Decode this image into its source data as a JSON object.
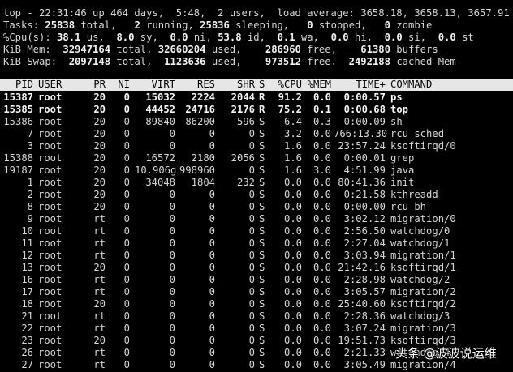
{
  "summary": {
    "l1": [
      {
        "t": "top - 22:31:46 up 464 days,  5:48,  2 users,  load average: 3658.18, 3658.13, 3657.91",
        "b": false
      }
    ],
    "l2": [
      {
        "t": "Tasks: ",
        "b": false
      },
      {
        "t": "25838",
        "b": true
      },
      {
        "t": " total,   ",
        "b": false
      },
      {
        "t": "2",
        "b": true
      },
      {
        "t": " running, ",
        "b": false
      },
      {
        "t": "25836",
        "b": true
      },
      {
        "t": " sleeping,   ",
        "b": false
      },
      {
        "t": "0",
        "b": true
      },
      {
        "t": " stopped,   ",
        "b": false
      },
      {
        "t": "0",
        "b": true
      },
      {
        "t": " zombie",
        "b": false
      }
    ],
    "l3": [
      {
        "t": "%Cpu(s): ",
        "b": false
      },
      {
        "t": "38.1",
        "b": true
      },
      {
        "t": " us,  ",
        "b": false
      },
      {
        "t": "8.0",
        "b": true
      },
      {
        "t": " sy,  ",
        "b": false
      },
      {
        "t": "0.0",
        "b": true
      },
      {
        "t": " ni, ",
        "b": false
      },
      {
        "t": "53.8",
        "b": true
      },
      {
        "t": " id,  ",
        "b": false
      },
      {
        "t": "0.1",
        "b": true
      },
      {
        "t": " wa,  ",
        "b": false
      },
      {
        "t": "0.0",
        "b": true
      },
      {
        "t": " hi,  ",
        "b": false
      },
      {
        "t": "0.0",
        "b": true
      },
      {
        "t": " si,  ",
        "b": false
      },
      {
        "t": "0.0",
        "b": true
      },
      {
        "t": " st",
        "b": false
      }
    ],
    "l4": [
      {
        "t": "KiB Mem:  ",
        "b": false
      },
      {
        "t": "32947164",
        "b": true
      },
      {
        "t": " total, ",
        "b": false
      },
      {
        "t": "32660204",
        "b": true
      },
      {
        "t": " used,    ",
        "b": false
      },
      {
        "t": "286960",
        "b": true
      },
      {
        "t": " free,    ",
        "b": false
      },
      {
        "t": "61380",
        "b": true
      },
      {
        "t": " buffers",
        "b": false
      }
    ],
    "l5": [
      {
        "t": "KiB Swap:  ",
        "b": false
      },
      {
        "t": "2097148",
        "b": true
      },
      {
        "t": " total,  ",
        "b": false
      },
      {
        "t": "1123636",
        "b": true
      },
      {
        "t": " used,    ",
        "b": false
      },
      {
        "t": "973512",
        "b": true
      },
      {
        "t": " free.  ",
        "b": false
      },
      {
        "t": "2492188",
        "b": true
      },
      {
        "t": " cached Mem",
        "b": false
      }
    ]
  },
  "columns": [
    "PID",
    "USER",
    "PR",
    "NI",
    "VIRT",
    "RES",
    "SHR",
    "S",
    "%CPU",
    "%MEM",
    "TIME+",
    "COMMAND"
  ],
  "processes": [
    {
      "pid": "15387",
      "user": "root",
      "pr": "20",
      "ni": "0",
      "virt": "15032",
      "res": "2224",
      "shr": "2044",
      "s": "R",
      "cpu": "91.2",
      "mem": "0.0",
      "time": "0:00.57",
      "cmd": "ps",
      "bold": true
    },
    {
      "pid": "15385",
      "user": "root",
      "pr": "20",
      "ni": "0",
      "virt": "44452",
      "res": "24716",
      "shr": "2176",
      "s": "R",
      "cpu": "75.2",
      "mem": "0.1",
      "time": "0:00.68",
      "cmd": "top",
      "bold": true
    },
    {
      "pid": "15386",
      "user": "root",
      "pr": "20",
      "ni": "0",
      "virt": "89840",
      "res": "86200",
      "shr": "596",
      "s": "S",
      "cpu": "6.4",
      "mem": "0.3",
      "time": "0:00.09",
      "cmd": "sh",
      "bold": false
    },
    {
      "pid": "7",
      "user": "root",
      "pr": "20",
      "ni": "0",
      "virt": "0",
      "res": "0",
      "shr": "0",
      "s": "S",
      "cpu": "3.2",
      "mem": "0.0",
      "time": "766:13.30",
      "cmd": "rcu_sched",
      "bold": false
    },
    {
      "pid": "3",
      "user": "root",
      "pr": "20",
      "ni": "0",
      "virt": "0",
      "res": "0",
      "shr": "0",
      "s": "S",
      "cpu": "1.6",
      "mem": "0.0",
      "time": "23:57.24",
      "cmd": "ksoftirqd/0",
      "bold": false
    },
    {
      "pid": "15388",
      "user": "root",
      "pr": "20",
      "ni": "0",
      "virt": "16572",
      "res": "2180",
      "shr": "2056",
      "s": "S",
      "cpu": "1.6",
      "mem": "0.0",
      "time": "0:00.01",
      "cmd": "grep",
      "bold": false
    },
    {
      "pid": "19187",
      "user": "root",
      "pr": "20",
      "ni": "0",
      "virt": "10.906g",
      "res": "998960",
      "shr": "0",
      "s": "S",
      "cpu": "1.6",
      "mem": "3.0",
      "time": "4:51.99",
      "cmd": "java",
      "bold": false
    },
    {
      "pid": "1",
      "user": "root",
      "pr": "20",
      "ni": "0",
      "virt": "34048",
      "res": "1804",
      "shr": "232",
      "s": "S",
      "cpu": "0.0",
      "mem": "0.0",
      "time": "80:41.36",
      "cmd": "init",
      "bold": false
    },
    {
      "pid": "2",
      "user": "root",
      "pr": "20",
      "ni": "0",
      "virt": "0",
      "res": "0",
      "shr": "0",
      "s": "S",
      "cpu": "0.0",
      "mem": "0.0",
      "time": "0:21.58",
      "cmd": "kthreadd",
      "bold": false
    },
    {
      "pid": "8",
      "user": "root",
      "pr": "20",
      "ni": "0",
      "virt": "0",
      "res": "0",
      "shr": "0",
      "s": "S",
      "cpu": "0.0",
      "mem": "0.0",
      "time": "0:00.00",
      "cmd": "rcu_bh",
      "bold": false
    },
    {
      "pid": "9",
      "user": "root",
      "pr": "rt",
      "ni": "0",
      "virt": "0",
      "res": "0",
      "shr": "0",
      "s": "S",
      "cpu": "0.0",
      "mem": "0.0",
      "time": "3:02.12",
      "cmd": "migration/0",
      "bold": false
    },
    {
      "pid": "10",
      "user": "root",
      "pr": "rt",
      "ni": "0",
      "virt": "0",
      "res": "0",
      "shr": "0",
      "s": "S",
      "cpu": "0.0",
      "mem": "0.0",
      "time": "2:56.50",
      "cmd": "watchdog/0",
      "bold": false
    },
    {
      "pid": "11",
      "user": "root",
      "pr": "rt",
      "ni": "0",
      "virt": "0",
      "res": "0",
      "shr": "0",
      "s": "S",
      "cpu": "0.0",
      "mem": "0.0",
      "time": "2:27.04",
      "cmd": "watchdog/1",
      "bold": false
    },
    {
      "pid": "12",
      "user": "root",
      "pr": "rt",
      "ni": "0",
      "virt": "0",
      "res": "0",
      "shr": "0",
      "s": "S",
      "cpu": "0.0",
      "mem": "0.0",
      "time": "3:03.94",
      "cmd": "migration/1",
      "bold": false
    },
    {
      "pid": "13",
      "user": "root",
      "pr": "20",
      "ni": "0",
      "virt": "0",
      "res": "0",
      "shr": "0",
      "s": "S",
      "cpu": "0.0",
      "mem": "0.0",
      "time": "21:42.16",
      "cmd": "ksoftirqd/1",
      "bold": false
    },
    {
      "pid": "16",
      "user": "root",
      "pr": "rt",
      "ni": "0",
      "virt": "0",
      "res": "0",
      "shr": "0",
      "s": "S",
      "cpu": "0.0",
      "mem": "0.0",
      "time": "2:28.98",
      "cmd": "watchdog/2",
      "bold": false
    },
    {
      "pid": "17",
      "user": "root",
      "pr": "rt",
      "ni": "0",
      "virt": "0",
      "res": "0",
      "shr": "0",
      "s": "S",
      "cpu": "0.0",
      "mem": "0.0",
      "time": "3:05.57",
      "cmd": "migration/2",
      "bold": false
    },
    {
      "pid": "18",
      "user": "root",
      "pr": "20",
      "ni": "0",
      "virt": "0",
      "res": "0",
      "shr": "0",
      "s": "S",
      "cpu": "0.0",
      "mem": "0.0",
      "time": "25:40.60",
      "cmd": "ksoftirqd/2",
      "bold": false
    },
    {
      "pid": "21",
      "user": "root",
      "pr": "rt",
      "ni": "0",
      "virt": "0",
      "res": "0",
      "shr": "0",
      "s": "S",
      "cpu": "0.0",
      "mem": "0.0",
      "time": "2:28.36",
      "cmd": "watchdog/3",
      "bold": false
    },
    {
      "pid": "22",
      "user": "root",
      "pr": "rt",
      "ni": "0",
      "virt": "0",
      "res": "0",
      "shr": "0",
      "s": "S",
      "cpu": "0.0",
      "mem": "0.0",
      "time": "3:07.24",
      "cmd": "migration/3",
      "bold": false
    },
    {
      "pid": "23",
      "user": "root",
      "pr": "20",
      "ni": "0",
      "virt": "0",
      "res": "0",
      "shr": "0",
      "s": "S",
      "cpu": "0.0",
      "mem": "0.0",
      "time": "19:51.73",
      "cmd": "ksoftirqd/3",
      "bold": false
    },
    {
      "pid": "26",
      "user": "root",
      "pr": "rt",
      "ni": "0",
      "virt": "0",
      "res": "0",
      "shr": "0",
      "s": "S",
      "cpu": "0.0",
      "mem": "0.0",
      "time": "2:21.33",
      "cmd": "watchdog/4",
      "bold": false
    },
    {
      "pid": "27",
      "user": "root",
      "pr": "rt",
      "ni": "0",
      "virt": "0",
      "res": "0",
      "shr": "0",
      "s": "S",
      "cpu": "0.0",
      "mem": "0.0",
      "time": "3:05.49",
      "cmd": "migration/4",
      "bold": false
    }
  ],
  "watermark": {
    "text": "头条 @波波说运维"
  },
  "colors": {
    "background": "#000000",
    "text": "#d6d6d6",
    "header_bg": "#e6e6e6",
    "header_text": "#000000"
  }
}
